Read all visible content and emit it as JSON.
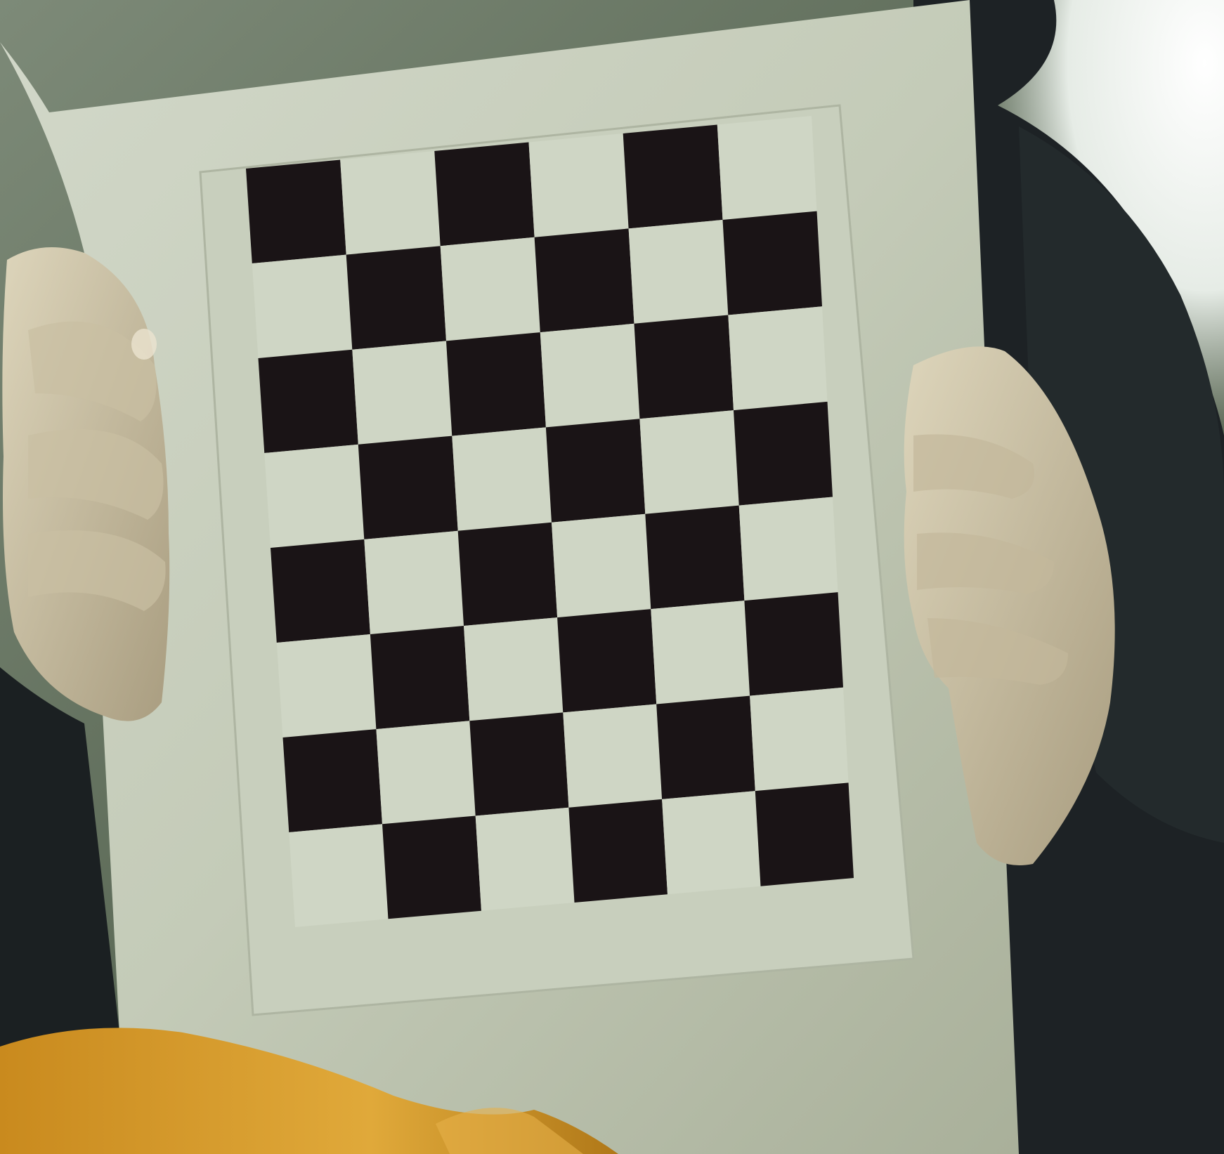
{
  "photo": {
    "subject": "",
    "palette": {
      "background_wall": "#6b7a66",
      "window_glow": "#f2f6f2",
      "hoodie": "#1c2124",
      "board_paper": "#d8ddd0",
      "board_paper_shadow": "#b9c0b0",
      "checker_dark": "#1a1416",
      "checker_light": "#cfd6c5",
      "skin": "#d6cdb2",
      "skin_shadow": "#a89c80",
      "foreground_cloth": "#d49a2a"
    },
    "checkerboard": {
      "rows": 8,
      "cols": 6,
      "pattern": "alternating",
      "first_cell_dark": false
    }
  }
}
